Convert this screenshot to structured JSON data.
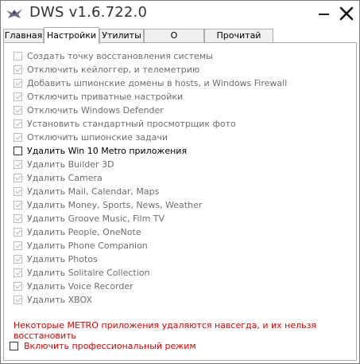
{
  "window": {
    "title": "DWS v1.6.722.0"
  },
  "tabs": [
    {
      "label": "Главная",
      "active": false
    },
    {
      "label": "Настройки",
      "active": true
    },
    {
      "label": "Утилиты",
      "active": false
    },
    {
      "label": "О программе",
      "active": false
    },
    {
      "label": "Прочитай меня",
      "active": false
    }
  ],
  "options": [
    {
      "label": "Создать точку восстановления системы",
      "checked": false,
      "enabled": false
    },
    {
      "label": "Отключить кейлоггер, и телеметрию",
      "checked": true,
      "enabled": false
    },
    {
      "label": "Добавить шпионские домены в hosts, и Windows Firewall",
      "checked": true,
      "enabled": false
    },
    {
      "label": "Отключить приватные настройки",
      "checked": true,
      "enabled": false
    },
    {
      "label": "Отключить Windows Defender",
      "checked": true,
      "enabled": false
    },
    {
      "label": "Установить стандартный просмотрщик фото",
      "checked": true,
      "enabled": false
    },
    {
      "label": "Отключить шпионские задачи",
      "checked": true,
      "enabled": false
    },
    {
      "label": "Удалить Win 10 Metro приложения",
      "checked": false,
      "enabled": true
    },
    {
      "label": "Удалить Builder 3D",
      "checked": true,
      "enabled": false
    },
    {
      "label": "Удалить Camera",
      "checked": true,
      "enabled": false
    },
    {
      "label": "Удалить Mail, Calendar, Maps",
      "checked": true,
      "enabled": false
    },
    {
      "label": "Удалить Money, Sports, News, Weather",
      "checked": true,
      "enabled": false
    },
    {
      "label": "Удалить Groove Music, Film TV",
      "checked": true,
      "enabled": false
    },
    {
      "label": "Удалить People, OneNote",
      "checked": true,
      "enabled": false
    },
    {
      "label": "Удалить Phone Companion",
      "checked": true,
      "enabled": false
    },
    {
      "label": "Удалить Photos",
      "checked": true,
      "enabled": false
    },
    {
      "label": "Удалить Solitaire Collection",
      "checked": true,
      "enabled": false
    },
    {
      "label": "Удалить Voice Recorder",
      "checked": true,
      "enabled": false
    },
    {
      "label": "Удалить XBOX",
      "checked": true,
      "enabled": false
    }
  ],
  "warning": "Некоторые METRO приложения удаляются навсегда, и их нельзя восстановить",
  "pro_mode": {
    "label": "Включить профессиональный режим",
    "checked": false
  },
  "colors": {
    "warning": "#e00000",
    "border": "#adadad"
  },
  "icons": {
    "app": "bird-logo-icon",
    "minimize": "minimize-icon",
    "close": "close-icon"
  }
}
